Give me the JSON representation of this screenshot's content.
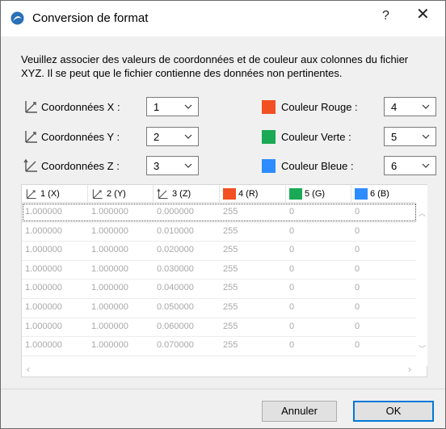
{
  "window": {
    "title": "Conversion de format",
    "help_label": "?",
    "close_label": "✕",
    "app_icon": "archicad-logo-icon"
  },
  "description": "Veuillez associer des valeurs de coordonnées et de couleur aux colonnes du fichier XYZ. Il se peut que le fichier contienne des données non pertinentes.",
  "coordinates": [
    {
      "label": "Coordonnées X :",
      "value": "1",
      "icon": "axis-x-icon"
    },
    {
      "label": "Coordonnées Y :",
      "value": "2",
      "icon": "axis-y-icon"
    },
    {
      "label": "Coordonnées Z :",
      "value": "3",
      "icon": "axis-z-icon"
    }
  ],
  "colors": [
    {
      "label": "Couleur Rouge :",
      "value": "4",
      "swatch": "#f25022"
    },
    {
      "label": "Couleur Verte :",
      "value": "5",
      "swatch": "#1aaa55"
    },
    {
      "label": "Couleur Bleue :",
      "value": "6",
      "swatch": "#2d8cff"
    }
  ],
  "table": {
    "columns": [
      {
        "label": "1 (X)",
        "icon": "axis-x-icon"
      },
      {
        "label": "2 (Y)",
        "icon": "axis-y-icon"
      },
      {
        "label": "3 (Z)",
        "icon": "axis-z-icon"
      },
      {
        "label": "4 (R)",
        "swatch": "#f25022"
      },
      {
        "label": "5 (G)",
        "swatch": "#1aaa55"
      },
      {
        "label": "6 (B)",
        "swatch": "#2d8cff"
      }
    ],
    "rows": [
      [
        "1.000000",
        "1.000000",
        "0.000000",
        "255",
        "0",
        "0"
      ],
      [
        "1.000000",
        "1.000000",
        "0.010000",
        "255",
        "0",
        "0"
      ],
      [
        "1.000000",
        "1.000000",
        "0.020000",
        "255",
        "0",
        "0"
      ],
      [
        "1.000000",
        "1.000000",
        "0.030000",
        "255",
        "0",
        "0"
      ],
      [
        "1.000000",
        "1.000000",
        "0.040000",
        "255",
        "0",
        "0"
      ],
      [
        "1.000000",
        "1.000000",
        "0.050000",
        "255",
        "0",
        "0"
      ],
      [
        "1.000000",
        "1.000000",
        "0.060000",
        "255",
        "0",
        "0"
      ],
      [
        "1.000000",
        "1.000000",
        "0.070000",
        "255",
        "0",
        "0"
      ]
    ],
    "selected_row": 0
  },
  "buttons": {
    "cancel": "Annuler",
    "ok": "OK"
  },
  "colors_ui": {
    "accent": "#0078d7"
  }
}
